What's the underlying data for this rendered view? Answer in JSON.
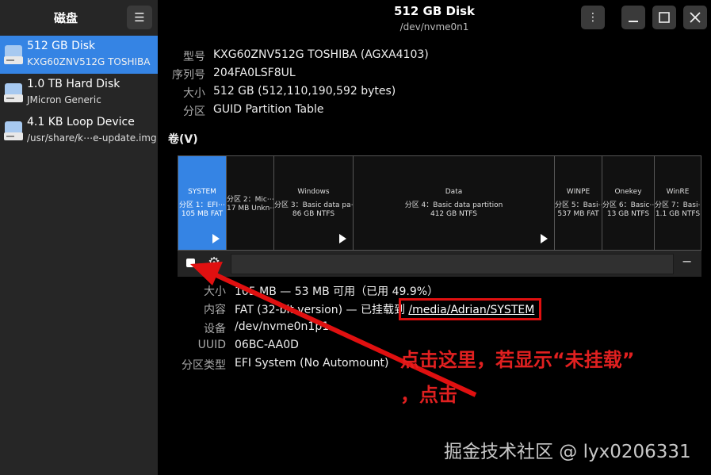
{
  "sidebar": {
    "title": "磁盘",
    "menu_icon": "hamburger-icon",
    "disks": [
      {
        "name": "512 GB Disk",
        "sub": "KXG60ZNV512G TOSHIBA",
        "selected": true
      },
      {
        "name": "1.0 TB Hard Disk",
        "sub": "JMicron Generic",
        "selected": false
      },
      {
        "name": "4.1 KB Loop Device",
        "sub": "/usr/share/k⋯e-update.img",
        "selected": false
      }
    ]
  },
  "header": {
    "title": "512 GB Disk",
    "subtitle": "/dev/nvme0n1",
    "kebab": "⋮"
  },
  "disk_info": [
    {
      "label": "型号",
      "value": "KXG60ZNV512G TOSHIBA (AGXA4103)"
    },
    {
      "label": "序列号",
      "value": "204FA0LSF8UL"
    },
    {
      "label": "大小",
      "value": "512 GB (512,110,190,592 bytes)"
    },
    {
      "label": "分区",
      "value": "GUID Partition Table"
    }
  ],
  "volumes": {
    "label": "卷(V)",
    "partitions": [
      {
        "name": "SYSTEM",
        "line2": "分区 1：EFI⋯",
        "line3": "105 MB FAT",
        "selected": true,
        "mounted_arrow": true
      },
      {
        "name": "",
        "line2": "分区 2：Mic⋯",
        "line3": "17 MB Unkn⋯",
        "selected": false,
        "mounted_arrow": false
      },
      {
        "name": "Windows",
        "line2": "分区 3：Basic data pa⋯",
        "line3": "86 GB NTFS",
        "selected": false,
        "mounted_arrow": true
      },
      {
        "name": "Data",
        "line2": "分区 4：Basic data partition",
        "line3": "412 GB NTFS",
        "selected": false,
        "mounted_arrow": true
      },
      {
        "name": "WINPE",
        "line2": "分区 5：Basi⋯",
        "line3": "537 MB FAT",
        "selected": false,
        "mounted_arrow": false
      },
      {
        "name": "Onekey",
        "line2": "分区 6：Basic⋯",
        "line3": "13 GB NTFS",
        "selected": false,
        "mounted_arrow": false
      },
      {
        "name": "WinRE",
        "line2": "分区 7：Basi⋯",
        "line3": "1.1 GB NTFS",
        "selected": false,
        "mounted_arrow": false
      }
    ]
  },
  "toolbar": {
    "minus": "−"
  },
  "partition_info": {
    "size": {
      "label": "大小",
      "value": "105 MB — 53 MB 可用（已用 49.9%）"
    },
    "content": {
      "label": "内容",
      "value": "FAT (32-bit version) — 已挂载到 ",
      "link": "/media/Adrian/SYSTEM"
    },
    "device": {
      "label": "设备",
      "value": "/dev/nvme0n1p1"
    },
    "uuid": {
      "label": "UUID",
      "value": "06BC-AA0D"
    },
    "type": {
      "label": "分区类型",
      "value": "EFI System (No Automount)"
    }
  },
  "annotation": {
    "line1": "点击这里，若显示“未挂载”",
    "line2": "，点击",
    "color": "#e01010"
  },
  "watermark": "掘金技术社区 @ lyx0206331",
  "colors": {
    "accent": "#3584e4",
    "sidebar_bg": "#262626",
    "background": "#000000"
  }
}
